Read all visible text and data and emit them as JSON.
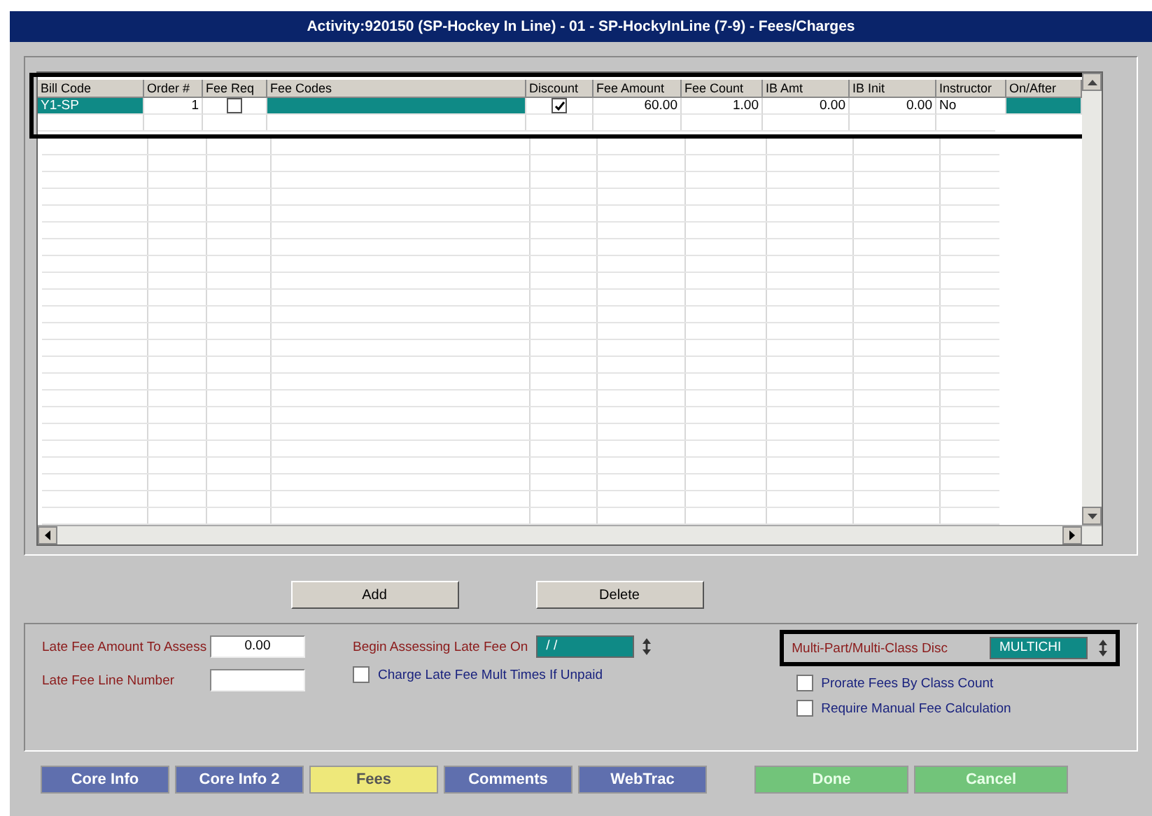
{
  "window": {
    "title": "Activity:920150 (SP-Hockey In Line) - 01 - SP-HockyInLine (7-9) - Fees/Charges"
  },
  "grid": {
    "columns": [
      {
        "label": "Bill Code",
        "kind": "text",
        "locked": true
      },
      {
        "label": "Order #",
        "kind": "number",
        "locked": false
      },
      {
        "label": "Fee Req",
        "kind": "check",
        "locked": false
      },
      {
        "label": "Fee Codes",
        "kind": "text",
        "locked": true
      },
      {
        "label": "Discount",
        "kind": "check",
        "locked": false
      },
      {
        "label": "Fee Amount",
        "kind": "number",
        "locked": false
      },
      {
        "label": "Fee Count",
        "kind": "number",
        "locked": false
      },
      {
        "label": "IB Amt",
        "kind": "number",
        "locked": false
      },
      {
        "label": "IB Init",
        "kind": "number",
        "locked": false
      },
      {
        "label": "Instructor",
        "kind": "text",
        "locked": false
      },
      {
        "label": "On/After",
        "kind": "text",
        "locked": true
      }
    ],
    "rows": [
      {
        "selected": true,
        "cells": [
          {
            "text": "Y1-SP"
          },
          {
            "text": "1"
          },
          {
            "checked": false
          },
          {},
          {
            "checked": true
          },
          {
            "text": "60.00"
          },
          {
            "text": "1.00"
          },
          {
            "text": "0.00"
          },
          {
            "text": "0.00"
          },
          {
            "text": "No"
          },
          {}
        ]
      }
    ]
  },
  "actions": [
    {
      "label": "Add"
    },
    {
      "label": "Delete"
    }
  ],
  "late_fee": {
    "amount_label": "Late Fee Amount To Assess",
    "amount_value": "0.00",
    "line_label": "Late Fee Line Number",
    "begin_label": "Begin Assessing Late Fee On",
    "begin_value": "/ /",
    "charge_multiple": {
      "label": "Charge Late Fee Mult Times If Unpaid",
      "checked": false
    }
  },
  "discount": {
    "label": "Multi-Part/Multi-Class Disc",
    "value": "MULTICHI",
    "options": [
      {
        "label": "Prorate Fees By Class Count",
        "checked": false
      },
      {
        "label": "Require Manual Fee Calculation",
        "checked": false
      }
    ]
  },
  "tabs": [
    {
      "label": "Core Info",
      "selected": false
    },
    {
      "label": "Core Info 2",
      "selected": false
    },
    {
      "label": "Fees",
      "selected": true
    },
    {
      "label": "Comments",
      "selected": false
    },
    {
      "label": "WebTrac",
      "selected": false
    }
  ],
  "buttons": [
    {
      "label": "Done"
    },
    {
      "label": "Cancel"
    }
  ]
}
